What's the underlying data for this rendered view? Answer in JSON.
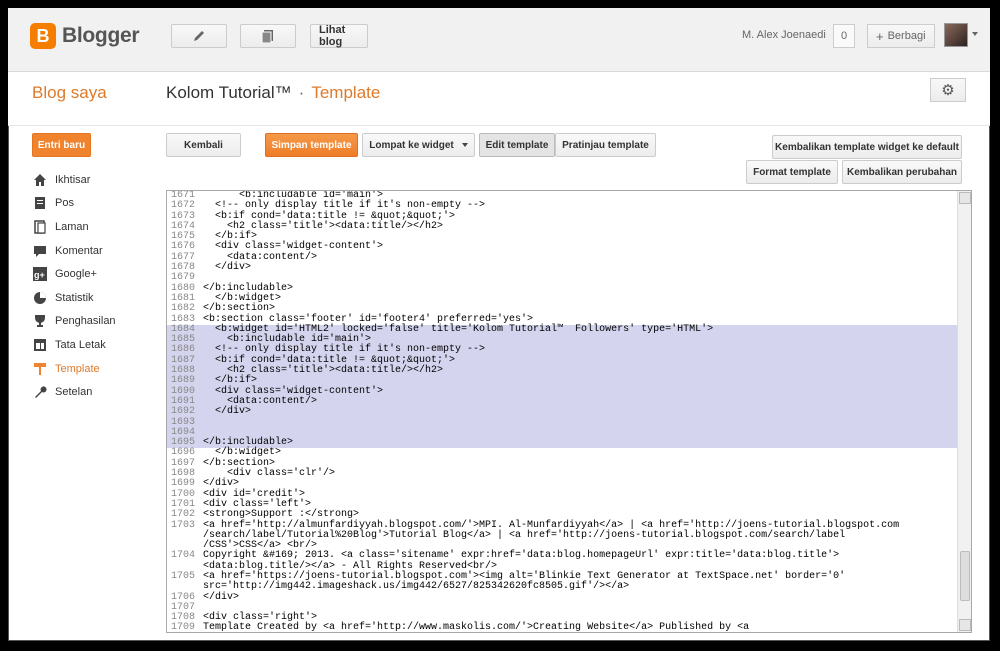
{
  "app": {
    "brand_letter": "B",
    "brand_name": "Blogger"
  },
  "topbar": {
    "view_blog_label": "Lihat blog",
    "user_name": "M. Alex Joenaedi",
    "notification_count": "0",
    "share_label": "Berbagi"
  },
  "header": {
    "my_blogs": "Blog saya",
    "blog_title": "Kolom Tutorial™",
    "separator": "·",
    "section": "Template"
  },
  "sidebar": {
    "new_post": "Entri baru",
    "items": [
      {
        "label": "Ikhtisar",
        "icon": "home-icon"
      },
      {
        "label": "Pos",
        "icon": "posts-icon"
      },
      {
        "label": "Laman",
        "icon": "pages-icon"
      },
      {
        "label": "Komentar",
        "icon": "comments-icon"
      },
      {
        "label": "Google+",
        "icon": "google-plus-icon"
      },
      {
        "label": "Statistik",
        "icon": "stats-icon"
      },
      {
        "label": "Penghasilan",
        "icon": "earnings-icon"
      },
      {
        "label": "Tata Letak",
        "icon": "layout-icon"
      },
      {
        "label": "Template",
        "icon": "template-icon"
      },
      {
        "label": "Setelan",
        "icon": "settings-icon"
      }
    ]
  },
  "toolbar": {
    "back": "Kembali",
    "save": "Simpan template",
    "jump": "Lompat ke widget",
    "edit": "Edit template",
    "preview": "Pratinjau template",
    "restore_widgets": "Kembalikan template widget ke default",
    "format": "Format template",
    "revert": "Kembalikan perubahan"
  },
  "editor": {
    "lines": [
      {
        "no": "1671",
        "text": "      <b:includable id='main'>",
        "sel": false
      },
      {
        "no": "1672",
        "text": "  <!-- only display title if it's non-empty -->",
        "sel": false
      },
      {
        "no": "1673",
        "text": "  <b:if cond='data:title != &quot;&quot;'>",
        "sel": false
      },
      {
        "no": "1674",
        "text": "    <h2 class='title'><data:title/></h2>",
        "sel": false
      },
      {
        "no": "1675",
        "text": "  </b:if>",
        "sel": false
      },
      {
        "no": "1676",
        "text": "  <div class='widget-content'>",
        "sel": false
      },
      {
        "no": "1677",
        "text": "    <data:content/>",
        "sel": false
      },
      {
        "no": "1678",
        "text": "  </div>",
        "sel": false
      },
      {
        "no": "1679",
        "text": "",
        "sel": false
      },
      {
        "no": "1680",
        "text": "</b:includable>",
        "sel": false
      },
      {
        "no": "1681",
        "text": "  </b:widget>",
        "sel": false
      },
      {
        "no": "1682",
        "text": "</b:section>",
        "sel": false
      },
      {
        "no": "1683",
        "text": "<b:section class='footer' id='footer4' preferred='yes'>",
        "sel": false
      },
      {
        "no": "1684",
        "text": "  <b:widget id='HTML2' locked='false' title='Kolom Tutorial™  Followers' type='HTML'>",
        "sel": true
      },
      {
        "no": "1685",
        "text": "    <b:includable id='main'>",
        "sel": true
      },
      {
        "no": "1686",
        "text": "  <!-- only display title if it's non-empty -->",
        "sel": true
      },
      {
        "no": "1687",
        "text": "  <b:if cond='data:title != &quot;&quot;'>",
        "sel": true
      },
      {
        "no": "1688",
        "text": "    <h2 class='title'><data:title/></h2>",
        "sel": true
      },
      {
        "no": "1689",
        "text": "  </b:if>",
        "sel": true
      },
      {
        "no": "1690",
        "text": "  <div class='widget-content'>",
        "sel": true
      },
      {
        "no": "1691",
        "text": "    <data:content/>",
        "sel": true
      },
      {
        "no": "1692",
        "text": "  </div>",
        "sel": true
      },
      {
        "no": "1693",
        "text": "",
        "sel": true
      },
      {
        "no": "1694",
        "text": "",
        "sel": true
      },
      {
        "no": "1695",
        "text": "</b:includable>",
        "sel": true
      },
      {
        "no": "1696",
        "text": "  </b:widget>",
        "sel": false
      },
      {
        "no": "1697",
        "text": "</b:section>",
        "sel": false
      },
      {
        "no": "1698",
        "text": "    <div class='clr'/>",
        "sel": false
      },
      {
        "no": "1699",
        "text": "</div>",
        "sel": false
      },
      {
        "no": "1700",
        "text": "<div id='credit'>",
        "sel": false
      },
      {
        "no": "1701",
        "text": "<div class='left'>",
        "sel": false
      },
      {
        "no": "1702",
        "text": "<strong>Support :</strong>",
        "sel": false
      },
      {
        "no": "1703",
        "text": "<a href='http://almunfardiyyah.blogspot.com/'>MPI. Al-Munfardiyyah</a> | <a href='http://joens-tutorial.blogspot.com\n/search/label/Tutorial%20Blog'>Tutorial Blog</a> | <a href='http://joens-tutorial.blogspot.com/search/label\n/CSS'>CSS</a> <br/>",
        "sel": false,
        "rows": 3
      },
      {
        "no": "1704",
        "text": "Copyright &#169; 2013. <a class='sitename' expr:href='data:blog.homepageUrl' expr:title='data:blog.title'>\n<data:blog.title/></a> - All Rights Reserved<br/>",
        "sel": false,
        "rows": 2
      },
      {
        "no": "1705",
        "text": "<a href='https://joens-tutorial.blogspot.com'><img alt='Blinkie Text Generator at TextSpace.net' border='0'\nsrc='http://img442.imageshack.us/img442/6527/825342620fc8505.gif'/></a>",
        "sel": false,
        "rows": 2
      },
      {
        "no": "1706",
        "text": "</div>",
        "sel": false
      },
      {
        "no": "1707",
        "text": "",
        "sel": false
      },
      {
        "no": "1708",
        "text": "<div class='right'>",
        "sel": false
      },
      {
        "no": "1709",
        "text": "Template Created by <a href='http://www.maskolis.com/'>Creating Website</a> Published by <a\nhref='http://www.mastemplate.com/'>Mas Template</a><br/>",
        "sel": false,
        "rows": 2
      }
    ]
  }
}
